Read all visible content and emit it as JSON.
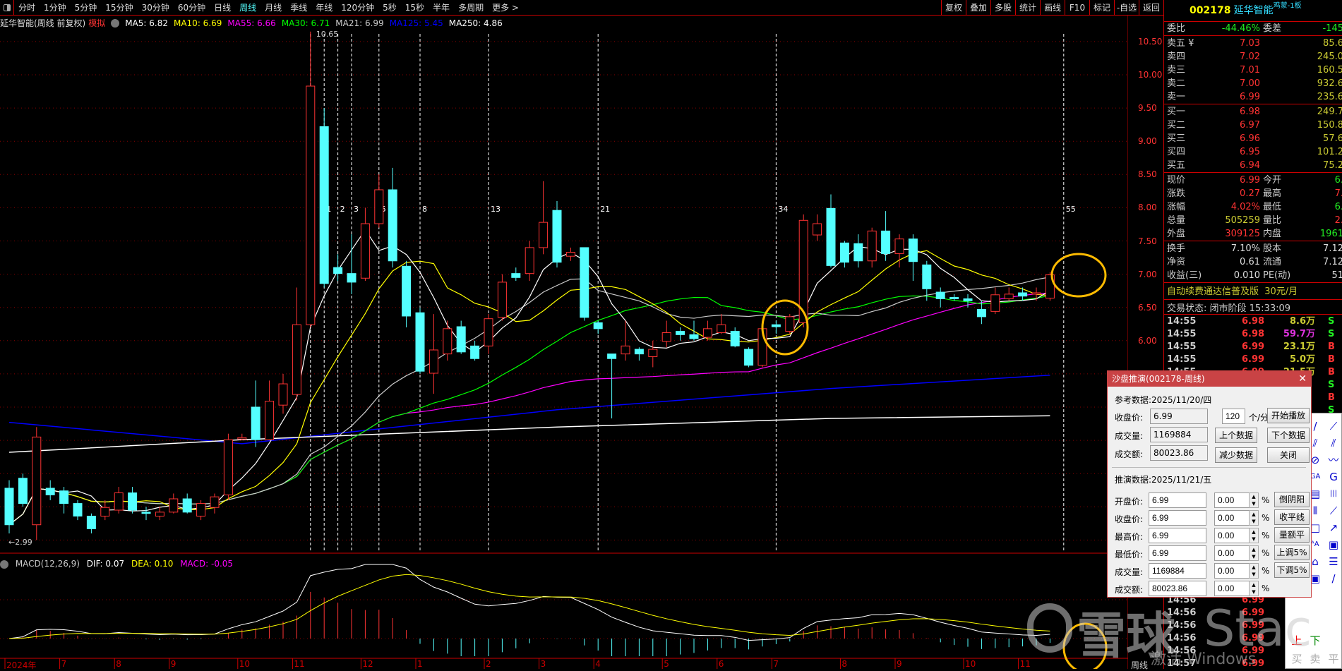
{
  "toolbar": {
    "periods": [
      "分时",
      "1分钟",
      "5分钟",
      "15分钟",
      "30分钟",
      "60分钟",
      "日线",
      "周线",
      "月线",
      "季线",
      "年线",
      "120分钟",
      "5秒",
      "15秒",
      "半年",
      "多周期",
      "更多 >"
    ],
    "active": "周线",
    "buttons": [
      "复权",
      "叠加",
      "多股",
      "统计",
      "画线",
      "F10",
      "标记",
      "-自选",
      "返回"
    ]
  },
  "legend": {
    "title": "延华智能(周线 前复权)",
    "mode": "模拟",
    "ma": [
      {
        "label": "MA5: 6.82",
        "color": "#ffffff"
      },
      {
        "label": "MA10: 6.69",
        "color": "#ffff00"
      },
      {
        "label": "MA55: 6.66",
        "color": "#ff00ff"
      },
      {
        "label": "MA30: 6.71",
        "color": "#00ff00"
      },
      {
        "label": "MA21: 6.99",
        "color": "#cccccc"
      },
      {
        "label": "MA125: 5.45",
        "color": "#0000ff"
      },
      {
        "label": "MA250: 4.86",
        "color": "#ffffff"
      }
    ]
  },
  "chart_data": {
    "type": "candlestick",
    "period": "weekly",
    "price_ticks": [
      "10.50",
      "10.00",
      "9.50",
      "9.00",
      "8.50",
      "8.00",
      "7.50",
      "7.00",
      "6.50",
      "6.00"
    ],
    "price_tick_values": [
      10.5,
      10,
      9.5,
      9,
      8.5,
      8,
      7.5,
      7,
      6.5,
      6
    ],
    "high_label": "10.65",
    "low_label": "2.99",
    "date_labels": [
      "2024年",
      "7",
      "8",
      "9",
      "10",
      "11",
      "12",
      "1",
      "2",
      "3",
      "4",
      "5",
      "6",
      "7",
      "8",
      "9",
      "10",
      "11"
    ],
    "date_label_index": [
      0,
      4,
      8,
      12,
      17,
      21,
      26,
      30,
      35,
      39,
      43,
      48,
      52,
      56,
      61,
      65,
      70,
      74
    ],
    "fib_labels": [
      "1",
      "2",
      "3",
      "5",
      "8",
      "13",
      "21",
      "34",
      "55"
    ],
    "fib_base": 22,
    "fib_offsets": [
      1,
      2,
      3,
      5,
      8,
      13,
      21,
      34,
      55
    ],
    "candles": [
      [
        3.78,
        3.23,
        3.9,
        3.1
      ],
      [
        3.93,
        3.55,
        4.0,
        3.5
      ],
      [
        3.23,
        4.55,
        4.7,
        3.0
      ],
      [
        3.78,
        3.68,
        3.9,
        3.6
      ],
      [
        3.74,
        3.55,
        3.8,
        3.4
      ],
      [
        3.55,
        3.36,
        3.6,
        3.3
      ],
      [
        3.36,
        3.17,
        3.4,
        3.1
      ],
      [
        3.36,
        3.49,
        3.6,
        3.3
      ],
      [
        3.45,
        3.71,
        3.8,
        3.4
      ],
      [
        3.71,
        3.45,
        3.8,
        3.4
      ],
      [
        3.42,
        3.4,
        3.5,
        3.3
      ],
      [
        3.36,
        3.42,
        3.5,
        3.3
      ],
      [
        3.42,
        3.62,
        3.7,
        3.4
      ],
      [
        3.62,
        3.42,
        3.7,
        3.4
      ],
      [
        3.36,
        3.55,
        3.6,
        3.3
      ],
      [
        3.49,
        3.65,
        3.7,
        3.4
      ],
      [
        3.68,
        4.51,
        4.6,
        3.6
      ],
      [
        4.52,
        4.54,
        4.6,
        4.5
      ],
      [
        5.0,
        4.51,
        5.4,
        4.4
      ],
      [
        4.51,
        5.09,
        5.4,
        4.5
      ],
      [
        5.03,
        5.35,
        5.5,
        4.9
      ],
      [
        5.19,
        6.24,
        6.8,
        5.1
      ],
      [
        6.24,
        9.83,
        10.65,
        6.2
      ],
      [
        9.22,
        6.86,
        9.5,
        6.8
      ],
      [
        7.1,
        7.01,
        7.3,
        6.9
      ],
      [
        7.01,
        6.88,
        7.6,
        6.7
      ],
      [
        6.94,
        7.76,
        8.0,
        6.9
      ],
      [
        7.76,
        8.27,
        8.5,
        7.7
      ],
      [
        8.27,
        7.2,
        8.6,
        7.1
      ],
      [
        7.12,
        6.37,
        7.2,
        6.2
      ],
      [
        6.42,
        5.54,
        6.5,
        5.5
      ],
      [
        5.51,
        5.86,
        6.4,
        5.2
      ],
      [
        5.8,
        6.18,
        6.3,
        5.7
      ],
      [
        6.21,
        5.83,
        6.3,
        5.8
      ],
      [
        5.92,
        5.73,
        6.0,
        5.7
      ],
      [
        5.92,
        6.33,
        6.4,
        5.8
      ],
      [
        6.35,
        6.88,
        7.0,
        6.3
      ],
      [
        7.01,
        6.95,
        7.1,
        6.9
      ],
      [
        7.01,
        7.4,
        7.5,
        6.9
      ],
      [
        7.4,
        7.78,
        8.4,
        7.3
      ],
      [
        7.96,
        7.18,
        8.1,
        7.1
      ],
      [
        7.27,
        7.33,
        7.4,
        7.2
      ],
      [
        7.4,
        6.35,
        7.4,
        6.3
      ],
      [
        6.27,
        6.18,
        6.3,
        6.1
      ],
      [
        5.8,
        5.73,
        5.8,
        4.83
      ],
      [
        5.8,
        5.92,
        6.3,
        5.7
      ],
      [
        5.87,
        5.8,
        5.9,
        5.7
      ],
      [
        5.76,
        5.87,
        6.0,
        5.6
      ],
      [
        5.99,
        6.12,
        6.3,
        5.9
      ],
      [
        6.14,
        6.09,
        6.2,
        6.0
      ],
      [
        6.09,
        6.03,
        6.3,
        6.0
      ],
      [
        6.05,
        6.18,
        6.3,
        6.0
      ],
      [
        6.12,
        6.24,
        6.4,
        6.1
      ],
      [
        6.14,
        5.92,
        6.2,
        5.9
      ],
      [
        5.87,
        5.63,
        5.9,
        5.6
      ],
      [
        5.63,
        6.18,
        6.3,
        5.6
      ],
      [
        6.24,
        6.21,
        6.3,
        6.1
      ],
      [
        6.14,
        6.36,
        6.4,
        6.1
      ],
      [
        6.27,
        7.81,
        7.9,
        6.2
      ],
      [
        7.59,
        7.76,
        7.9,
        7.5
      ],
      [
        7.99,
        7.13,
        8.2,
        7.1
      ],
      [
        7.47,
        7.18,
        7.5,
        7.1
      ],
      [
        7.46,
        7.2,
        7.6,
        7.1
      ],
      [
        7.2,
        7.65,
        7.7,
        7.1
      ],
      [
        7.65,
        7.31,
        7.95,
        7.2
      ],
      [
        7.31,
        7.53,
        7.6,
        7.1
      ],
      [
        7.53,
        7.19,
        7.6,
        6.9
      ],
      [
        7.14,
        6.78,
        7.2,
        6.6
      ],
      [
        6.73,
        6.63,
        6.8,
        6.5
      ],
      [
        6.65,
        6.63,
        6.7,
        6.6
      ],
      [
        6.63,
        6.6,
        6.7,
        6.5
      ],
      [
        6.47,
        6.36,
        6.6,
        6.25
      ],
      [
        6.44,
        6.69,
        6.8,
        6.4
      ],
      [
        6.63,
        6.7,
        6.8,
        6.6
      ],
      [
        6.72,
        6.67,
        6.8,
        6.6
      ],
      [
        6.7,
        6.72,
        6.8,
        6.6
      ],
      [
        6.64,
        6.99,
        7.03,
        6.6
      ]
    ],
    "ma125_samples": {
      "index": [
        0,
        17,
        40,
        60,
        76
      ],
      "values": [
        4.77,
        4.45,
        4.96,
        5.28,
        5.48
      ]
    },
    "ma250_samples": {
      "index": [
        0,
        17,
        40,
        60,
        76
      ],
      "values": [
        4.32,
        4.51,
        4.7,
        4.83,
        4.87
      ]
    },
    "macd": {
      "label": "MACD(12,26,9)",
      "dif": "DIF: 0.07",
      "dea": "DEA: 0.10",
      "macd": "MACD: -0.05"
    },
    "colors": {
      "up": "#ff3333",
      "down": "#54ffff",
      "ma5": "#ffffff",
      "ma10": "#ffff00",
      "ma21": "#cccccc",
      "ma30": "#00ff00",
      "ma55": "#ff00ff",
      "ma125": "#0000ff",
      "ma250": "#ffffff"
    }
  },
  "quote": {
    "code": "002178",
    "name": "延华智能",
    "tag": "鸡蒙-1板",
    "weibi": {
      "label": "委比",
      "value": "-44.46%",
      "label2": "委差",
      "value2": "-145"
    },
    "asks": [
      {
        "l": "卖五 ¥",
        "p": "7.03",
        "v": "85.6"
      },
      {
        "l": "卖四",
        "p": "7.02",
        "v": "245.0"
      },
      {
        "l": "卖三",
        "p": "7.01",
        "v": "160.5"
      },
      {
        "l": "卖二",
        "p": "7.00",
        "v": "932.6"
      },
      {
        "l": "卖一",
        "p": "6.99",
        "v": "235.6"
      }
    ],
    "bids": [
      {
        "l": "买一",
        "p": "6.98",
        "v": "249.7"
      },
      {
        "l": "买二",
        "p": "6.97",
        "v": "150.8"
      },
      {
        "l": "买三",
        "p": "6.96",
        "v": "57.6"
      },
      {
        "l": "买四",
        "p": "6.95",
        "v": "101.2"
      },
      {
        "l": "买五",
        "p": "6.94",
        "v": "75.2"
      }
    ],
    "stats": [
      {
        "l": "现价",
        "v": "6.99",
        "l2": "今开",
        "v2": "6."
      },
      {
        "l": "涨跌",
        "v": "0.27",
        "l2": "最高",
        "v2": "7."
      },
      {
        "l": "涨幅",
        "v": "4.02%",
        "l2": "最低",
        "v2": "6."
      },
      {
        "l": "总量",
        "v": "505259",
        "l2": "量比",
        "v2": "2."
      },
      {
        "l": "外盘",
        "v": "309125",
        "l2": "内盘",
        "v2": "1961"
      }
    ],
    "fund": [
      {
        "l": "换手",
        "v": "7.10%",
        "l2": "股本",
        "v2": "7.12"
      },
      {
        "l": "净资",
        "v": "0.61",
        "l2": "流通",
        "v2": "7.12"
      },
      {
        "l": "收益(三)",
        "v": "0.010",
        "l2": "PE(动)",
        "v2": "51"
      }
    ],
    "promo": "自动续费通达信普及版  30元/月",
    "status": "交易状态: 闭市阶段 15:33:09",
    "trades": [
      {
        "t": "14:55",
        "p": "6.98",
        "v": "8.6万",
        "s": "S"
      },
      {
        "t": "14:55",
        "p": "6.98",
        "v": "59.7万",
        "s": "S"
      },
      {
        "t": "14:55",
        "p": "6.99",
        "v": "23.1万",
        "s": "B"
      },
      {
        "t": "14:55",
        "p": "6.99",
        "v": "5.0万",
        "s": "B"
      },
      {
        "t": "14:55",
        "p": "6.99",
        "v": "21.5万",
        "s": "B"
      },
      {
        "t": "",
        "p": "",
        "v": "",
        "s": "S"
      },
      {
        "t": "",
        "p": "",
        "v": "",
        "s": "B"
      },
      {
        "t": "",
        "p": "",
        "v": "",
        "s": "S"
      }
    ],
    "trades_tail": [
      {
        "t": "14:56",
        "p": "6.99"
      },
      {
        "t": "14:56",
        "p": "6.99"
      },
      {
        "t": "14:56",
        "p": "6.99"
      },
      {
        "t": "14:56",
        "p": "6.99"
      },
      {
        "t": "14:56",
        "p": "6.99"
      },
      {
        "t": "14:57",
        "p": "6.99"
      }
    ]
  },
  "dialog": {
    "title": "沙盘推演(002178-周线)",
    "ref_label": "参考数据:2025/11/20/四",
    "ref": [
      {
        "l": "收盘价:",
        "v": "6.99"
      },
      {
        "l": "成交量:",
        "v": "1169884"
      },
      {
        "l": "成交额:",
        "v": "80023.86"
      }
    ],
    "speed": "120",
    "speed_unit": "个/分",
    "buttons": [
      "开始播放",
      "上个数据",
      "下个数据",
      "减少数据",
      "关闭"
    ],
    "sim_label": "推演数据:2025/11/21/五",
    "sim": [
      {
        "l": "开盘价:",
        "v": "6.99",
        "pct": "0.00",
        "b": "倒阴阳"
      },
      {
        "l": "收盘价:",
        "v": "6.99",
        "pct": "0.00",
        "b": "收平线"
      },
      {
        "l": "最高价:",
        "v": "6.99",
        "pct": "0.00",
        "b": "量额平"
      },
      {
        "l": "最低价:",
        "v": "6.99",
        "pct": "0.00",
        "b": "上调5%"
      },
      {
        "l": "成交量:",
        "v": "1169884",
        "pct": "0.00",
        "b": "下调5%"
      },
      {
        "l": "成交额:",
        "v": "80023.86",
        "pct": "0.00",
        "b": ""
      }
    ],
    "pct_sign": "%"
  },
  "drawbar": {
    "bottom_rows": [
      "上",
      "下",
      "买",
      "卖",
      "平"
    ]
  },
  "watermark": {
    "brand": "雪球",
    "text": "Stac",
    "windows": "激活 Windows"
  },
  "axis_footer": "周线"
}
